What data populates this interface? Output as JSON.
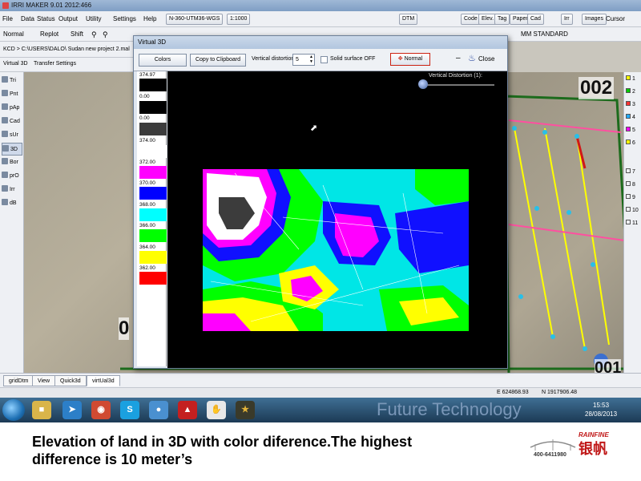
{
  "app": {
    "title": "IRRI MAKER  9.01   2012:466"
  },
  "menu": {
    "items": [
      "File",
      "Data",
      "Status",
      "Output",
      "Utility",
      "Settings",
      "Help"
    ],
    "projection": "N-360-UTM36-WGS",
    "scale": "1:1000",
    "right_buttons": [
      "DTM",
      "Code",
      "Elev.",
      "Tag",
      "Paper",
      "Cad",
      "Irr",
      "Images",
      "Cursor"
    ]
  },
  "toolbar2": {
    "items": [
      "Normal",
      "Replot",
      "Shift"
    ],
    "right_text": "MM STANDARD"
  },
  "path": {
    "text": "KCD > C:\\USERS\\DALO\\ Sudan new project 2.mal"
  },
  "tabs2": {
    "items": [
      "Virtual 3D",
      "Transfer Settings"
    ]
  },
  "left_tools": [
    "Tri",
    "Pnt",
    "pAp",
    "Cad",
    "sUr",
    "3D",
    "Bor",
    "prO",
    "Irr",
    "dB"
  ],
  "right_layers": [
    "1",
    "2",
    "3",
    "4",
    "5",
    "6",
    "7",
    "8",
    "9",
    "10",
    "11"
  ],
  "map_labels": [
    "002",
    "0",
    "001"
  ],
  "bottom_tabs": [
    "gridDtm",
    "View",
    "Quick3d",
    "virtUal3d"
  ],
  "status": {
    "east": "E 624868.93",
    "north": "N 1917906.48"
  },
  "taskbar": {
    "time": "15:53",
    "date": "28/08/2013",
    "banner": "Future Technology"
  },
  "virtual3d": {
    "title": "Virtual 3D",
    "colors_label": "Colors",
    "clipboard_label": "Copy to Clipboard",
    "distortion_label": "Vertical distortion",
    "distortion_value": "5",
    "solid_label": "Solid surface OFF",
    "normal_label": "Normal",
    "close_label": "Close",
    "slider_label": "Vertical Distortion (1):",
    "legend": [
      {
        "label": "374.97",
        "color": "#000000"
      },
      {
        "label": "0.00",
        "color": "#000000"
      },
      {
        "label": "0.00",
        "color": "#3c3c3c"
      },
      {
        "label": "374.00",
        "color": "#ffffff"
      },
      {
        "label": "372.00",
        "color": "#ff00ff"
      },
      {
        "label": "370.00",
        "color": "#0000ff"
      },
      {
        "label": "368.00",
        "color": "#00ffff"
      },
      {
        "label": "366.00",
        "color": "#00ff00"
      },
      {
        "label": "364.00",
        "color": "#ffff00"
      },
      {
        "label": "362.00",
        "color": "#ff0000"
      }
    ]
  },
  "caption": {
    "line1": "Elevation of land in 3D with color diference.The highest",
    "line2": "difference is 10 meter’s"
  },
  "logo": {
    "brand": "RAINFINE",
    "chinese": "银帆",
    "phone": "400-6411980"
  }
}
